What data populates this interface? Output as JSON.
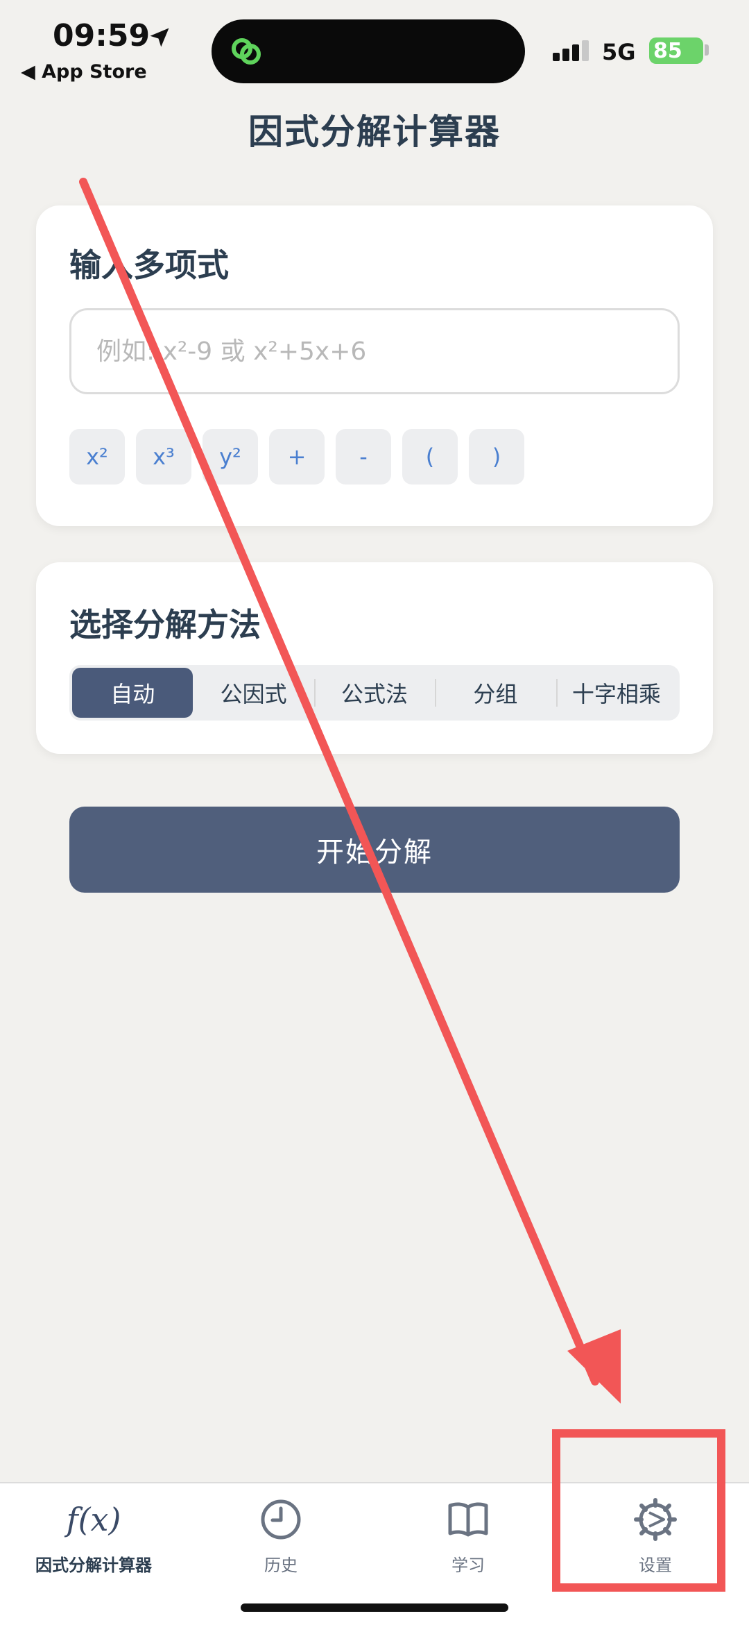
{
  "status_bar": {
    "time": "09:59",
    "back_label": "◀ App Store",
    "network": "5G",
    "battery": "85"
  },
  "page": {
    "title": "因式分解计算器"
  },
  "input_card": {
    "title": "输入多项式",
    "placeholder": "例如: x²-9 或 x²+5x+6",
    "keys": [
      "x²",
      "x³",
      "y²",
      "+",
      "-",
      "(",
      ")"
    ]
  },
  "method_card": {
    "title": "选择分解方法",
    "options": [
      "自动",
      "公因式",
      "公式法",
      "分组",
      "十字相乘"
    ],
    "selected": "自动"
  },
  "start_button": {
    "label": "开始分解"
  },
  "tabbar": {
    "items": [
      {
        "label": "因式分解计算器",
        "icon": "fx-icon",
        "icon_text": "f(x)"
      },
      {
        "label": "历史",
        "icon": "clock-icon"
      },
      {
        "label": "学习",
        "icon": "book-icon"
      },
      {
        "label": "设置",
        "icon": "gear-icon"
      }
    ],
    "active_index": 0
  },
  "colors": {
    "background": "#f2f1ee",
    "primary": "#505f7c",
    "key_text": "#4a7fd0",
    "annotation": "#f25656",
    "battery": "#6cd36a"
  }
}
